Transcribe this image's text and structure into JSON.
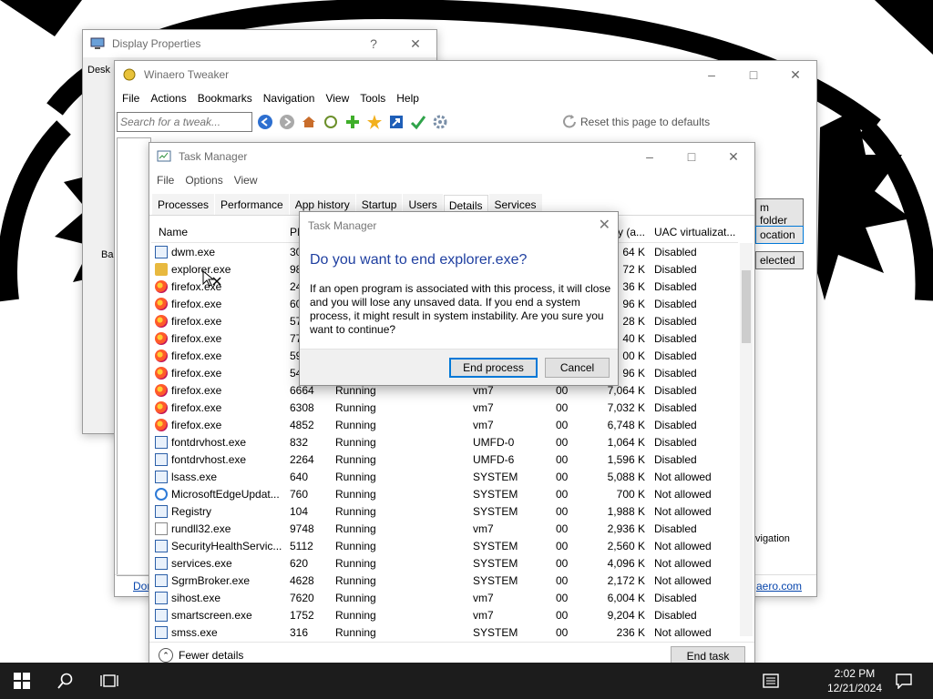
{
  "display_properties": {
    "title": "Display Properties",
    "help": "?",
    "close": "✕",
    "tab_stub": "Desk",
    "back_stub": "Bac"
  },
  "winaero": {
    "title": "Winaero Tweaker",
    "menu": [
      "File",
      "Actions",
      "Bookmarks",
      "Navigation",
      "View",
      "Tools",
      "Help"
    ],
    "search_placeholder": "Search for a tweak...",
    "reset_label": "Reset this page to defaults",
    "side_buttons": [
      "m folder",
      "ocation",
      "elected"
    ],
    "navigation_stub": "vigation",
    "bottom_left": "Dor",
    "bottom_right": "aero.com"
  },
  "task_manager": {
    "title": "Task Manager",
    "menu": [
      "File",
      "Options",
      "View"
    ],
    "tabs": [
      "Processes",
      "Performance",
      "App history",
      "Startup",
      "Users",
      "Details",
      "Services"
    ],
    "active_tab": "Details",
    "columns": {
      "name": "Name",
      "pid": "PI",
      "mem": "y (a...",
      "uac": "UAC virtualizat..."
    },
    "rows": [
      {
        "icon": "sys",
        "name": "dwm.exe",
        "pid": "30",
        "status": "",
        "user": "",
        "cpu": "",
        "mem": "64 K",
        "uac": "Disabled"
      },
      {
        "icon": "folder",
        "name": "explorer.exe",
        "pid": "98",
        "status": "",
        "user": "",
        "cpu": "",
        "mem": "72 K",
        "uac": "Disabled"
      },
      {
        "icon": "ff",
        "name": "firefox.exe",
        "pid": "24",
        "status": "",
        "user": "",
        "cpu": "",
        "mem": "36 K",
        "uac": "Disabled"
      },
      {
        "icon": "ff",
        "name": "firefox.exe",
        "pid": "60",
        "status": "",
        "user": "",
        "cpu": "",
        "mem": "96 K",
        "uac": "Disabled"
      },
      {
        "icon": "ff",
        "name": "firefox.exe",
        "pid": "57",
        "status": "",
        "user": "",
        "cpu": "",
        "mem": "28 K",
        "uac": "Disabled"
      },
      {
        "icon": "ff",
        "name": "firefox.exe",
        "pid": "77",
        "status": "",
        "user": "",
        "cpu": "",
        "mem": "40 K",
        "uac": "Disabled"
      },
      {
        "icon": "ff",
        "name": "firefox.exe",
        "pid": "59",
        "status": "",
        "user": "",
        "cpu": "",
        "mem": "00 K",
        "uac": "Disabled"
      },
      {
        "icon": "ff",
        "name": "firefox.exe",
        "pid": "54",
        "status": "",
        "user": "",
        "cpu": "",
        "mem": "96 K",
        "uac": "Disabled"
      },
      {
        "icon": "ff",
        "name": "firefox.exe",
        "pid": "6664",
        "status": "Running",
        "user": "vm7",
        "cpu": "00",
        "mem": "7,064 K",
        "uac": "Disabled"
      },
      {
        "icon": "ff",
        "name": "firefox.exe",
        "pid": "6308",
        "status": "Running",
        "user": "vm7",
        "cpu": "00",
        "mem": "7,032 K",
        "uac": "Disabled"
      },
      {
        "icon": "ff",
        "name": "firefox.exe",
        "pid": "4852",
        "status": "Running",
        "user": "vm7",
        "cpu": "00",
        "mem": "6,748 K",
        "uac": "Disabled"
      },
      {
        "icon": "sys",
        "name": "fontdrvhost.exe",
        "pid": "832",
        "status": "Running",
        "user": "UMFD-0",
        "cpu": "00",
        "mem": "1,064 K",
        "uac": "Disabled"
      },
      {
        "icon": "sys",
        "name": "fontdrvhost.exe",
        "pid": "2264",
        "status": "Running",
        "user": "UMFD-6",
        "cpu": "00",
        "mem": "1,596 K",
        "uac": "Disabled"
      },
      {
        "icon": "sys",
        "name": "lsass.exe",
        "pid": "640",
        "status": "Running",
        "user": "SYSTEM",
        "cpu": "00",
        "mem": "5,088 K",
        "uac": "Not allowed"
      },
      {
        "icon": "edge",
        "name": "MicrosoftEdgeUpdat...",
        "pid": "760",
        "status": "Running",
        "user": "SYSTEM",
        "cpu": "00",
        "mem": "700 K",
        "uac": "Not allowed"
      },
      {
        "icon": "sys",
        "name": "Registry",
        "pid": "104",
        "status": "Running",
        "user": "SYSTEM",
        "cpu": "00",
        "mem": "1,988 K",
        "uac": "Not allowed"
      },
      {
        "icon": "file",
        "name": "rundll32.exe",
        "pid": "9748",
        "status": "Running",
        "user": "vm7",
        "cpu": "00",
        "mem": "2,936 K",
        "uac": "Disabled"
      },
      {
        "icon": "sys",
        "name": "SecurityHealthServic...",
        "pid": "5112",
        "status": "Running",
        "user": "SYSTEM",
        "cpu": "00",
        "mem": "2,560 K",
        "uac": "Not allowed"
      },
      {
        "icon": "sys",
        "name": "services.exe",
        "pid": "620",
        "status": "Running",
        "user": "SYSTEM",
        "cpu": "00",
        "mem": "4,096 K",
        "uac": "Not allowed"
      },
      {
        "icon": "sys",
        "name": "SgrmBroker.exe",
        "pid": "4628",
        "status": "Running",
        "user": "SYSTEM",
        "cpu": "00",
        "mem": "2,172 K",
        "uac": "Not allowed"
      },
      {
        "icon": "sys",
        "name": "sihost.exe",
        "pid": "7620",
        "status": "Running",
        "user": "vm7",
        "cpu": "00",
        "mem": "6,004 K",
        "uac": "Disabled"
      },
      {
        "icon": "sys",
        "name": "smartscreen.exe",
        "pid": "1752",
        "status": "Running",
        "user": "vm7",
        "cpu": "00",
        "mem": "9,204 K",
        "uac": "Disabled"
      },
      {
        "icon": "sys",
        "name": "smss.exe",
        "pid": "316",
        "status": "Running",
        "user": "SYSTEM",
        "cpu": "00",
        "mem": "236 K",
        "uac": "Not allowed"
      }
    ],
    "fewer_details": "Fewer details",
    "end_task": "End task"
  },
  "dialog": {
    "title": "Task Manager",
    "heading": "Do you want to end explorer.exe?",
    "body": "If an open program is associated with this process, it will close and you will lose any unsaved data. If you end a system process, it might result in system instability. Are you sure you want to continue?",
    "end_process": "End process",
    "cancel": "Cancel"
  },
  "taskbar": {
    "time": "2:02 PM",
    "date": "12/21/2024"
  }
}
